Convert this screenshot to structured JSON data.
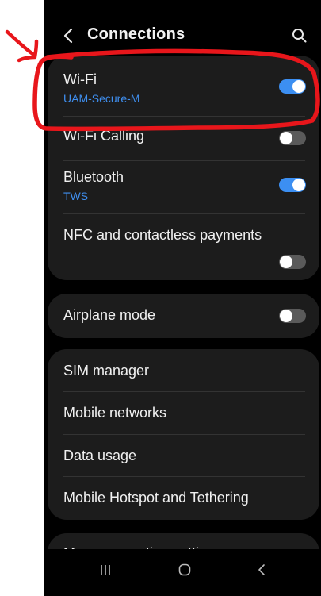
{
  "header": {
    "title": "Connections",
    "back_icon": "back-chevron-icon",
    "search_icon": "search-icon"
  },
  "settings": {
    "wifi": {
      "label": "Wi-Fi",
      "network": "UAM-Secure-M",
      "enabled": true
    },
    "wifi_calling": {
      "label": "Wi-Fi Calling",
      "enabled": false
    },
    "bluetooth": {
      "label": "Bluetooth",
      "device": "TWS",
      "enabled": true
    },
    "nfc": {
      "label": "NFC and contactless payments",
      "enabled": false
    },
    "airplane": {
      "label": "Airplane mode",
      "enabled": false
    },
    "sim_manager": {
      "label": "SIM manager"
    },
    "mobile_networks": {
      "label": "Mobile networks"
    },
    "data_usage": {
      "label": "Data usage"
    },
    "hotspot": {
      "label": "Mobile Hotspot and Tethering"
    },
    "more": {
      "label": "More connection settings"
    }
  },
  "navbar": {
    "recents_icon": "recents-icon",
    "home_icon": "home-icon",
    "back_icon": "back-icon"
  },
  "colors": {
    "background": "#000000",
    "card": "#1c1c1c",
    "accent": "#3c8ff2",
    "annotation": "#e8161b"
  }
}
